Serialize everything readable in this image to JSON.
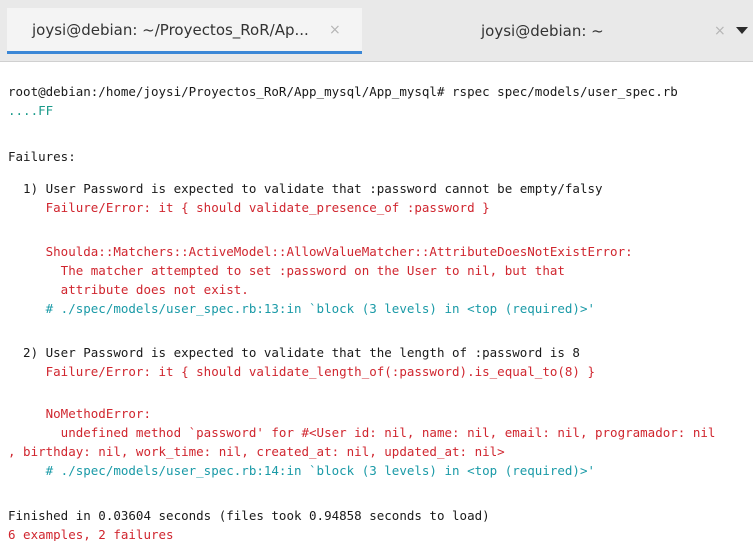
{
  "tabs": [
    {
      "title": "joysi@debian: ~/Proyectos_RoR/Ap...",
      "close": "×"
    },
    {
      "title": "joysi@debian: ~",
      "close": "×"
    }
  ],
  "icons": {
    "tab_close": "close-icon",
    "tab_menu": "chevron-down-icon"
  },
  "colors": {
    "default_text": "#1a1a1a",
    "failure_red": "#d0262f",
    "comment_cyan": "#1a9aa7",
    "active_tab_underline": "#3b87d6"
  },
  "terminal": {
    "prompt": "root@debian:/home/joysi/Proyectos_RoR/App_mysql/App_mysql# rspec spec/models/user_spec.rb",
    "progress": "....FF",
    "failures_header": "Failures:",
    "failure1": {
      "title": "  1) User Password is expected to validate that :password cannot be empty/falsy",
      "error": "     Failure/Error: it { should validate_presence_of :password }",
      "exception": "     Shoulda::Matchers::ActiveModel::AllowValueMatcher::AttributeDoesNotExistError:",
      "message1": "       The matcher attempted to set :password on the User to nil, but that",
      "message2": "       attribute does not exist.",
      "location": "     # ./spec/models/user_spec.rb:13:in `block (3 levels) in <top (required)>'"
    },
    "failure2": {
      "title": "  2) User Password is expected to validate that the length of :password is 8",
      "error": "     Failure/Error: it { should validate_length_of(:password).is_equal_to(8) }",
      "exception": "     NoMethodError:",
      "message1": "       undefined method `password' for #<User id: nil, name: nil, email: nil, programador: nil",
      "message2": ", birthday: nil, work_time: nil, created_at: nil, updated_at: nil>",
      "location": "     # ./spec/models/user_spec.rb:14:in `block (3 levels) in <top (required)>'"
    },
    "finished": "Finished in 0.03604 seconds (files took 0.94858 seconds to load)",
    "summary": "6 examples, 2 failures"
  }
}
